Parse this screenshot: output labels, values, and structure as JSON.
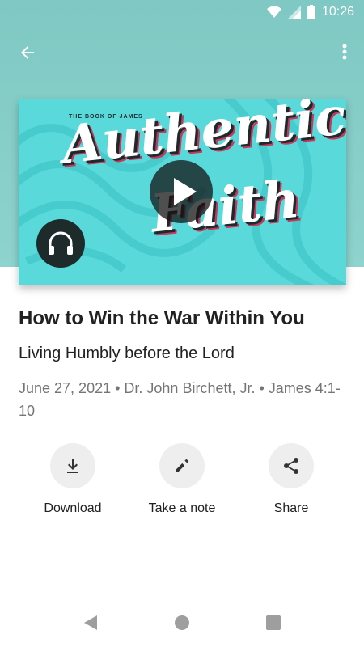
{
  "status_bar": {
    "time": "10:26",
    "icons": [
      "wifi-icon",
      "signal-icon",
      "battery-icon"
    ]
  },
  "toolbar": {
    "back_icon": "arrow-back-icon",
    "more_icon": "more-vert-icon"
  },
  "artwork": {
    "kicker": "THE BOOK OF JAMES",
    "title_line1": "Authentic",
    "title_line2": "Faith",
    "play_icon": "play-icon",
    "audio_icon": "headphones-icon"
  },
  "sermon": {
    "title": "How to Win the War Within You",
    "subtitle": "Living Humbly before the Lord",
    "meta": "June 27, 2021 • Dr. John Birchett, Jr. • James 4:1-10"
  },
  "actions": [
    {
      "label": "Download",
      "icon": "download-icon"
    },
    {
      "label": "Take a note",
      "icon": "pencil-icon"
    },
    {
      "label": "Share",
      "icon": "share-icon"
    }
  ],
  "nav": {
    "back_icon": "nav-back-icon",
    "home_icon": "nav-home-icon",
    "recents_icon": "nav-recents-icon"
  },
  "colors": {
    "header": "#8ed3cd",
    "artwork_bg": "#5ad9db",
    "action_circle": "#eeeeee"
  }
}
